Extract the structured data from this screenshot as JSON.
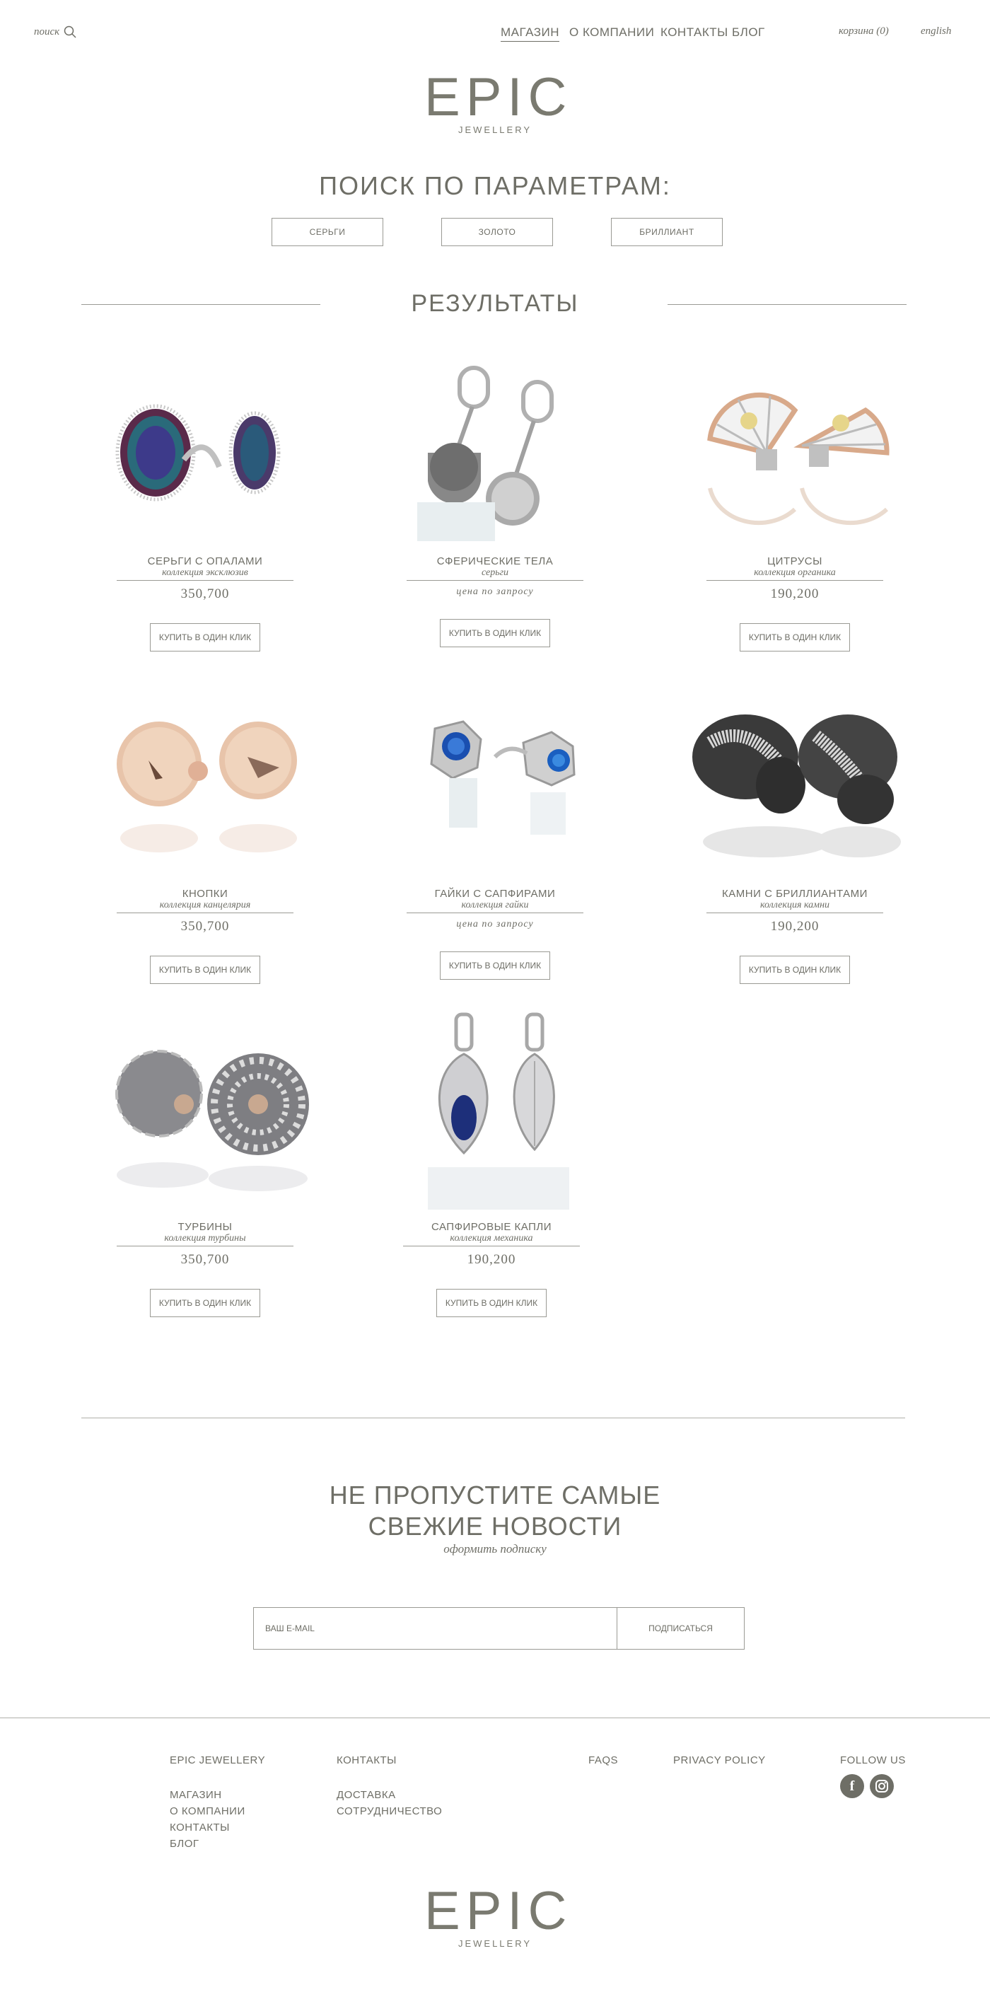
{
  "header": {
    "search_label": "поиск",
    "nav": [
      "МАГАЗИН",
      "О КОМПАНИИ",
      "КОНТАКТЫ",
      "БЛОГ"
    ],
    "cart": "корзина (0)",
    "language": "english"
  },
  "logo": {
    "word": "EPIC",
    "sub": "JEWELLERY"
  },
  "search_params": {
    "heading": "ПОИСК ПО ПАРАМЕТРАМ:",
    "filters": [
      "СЕРЬГИ",
      "ЗОЛОТО",
      "БРИЛЛИАНТ"
    ]
  },
  "results_heading": "РЕЗУЛЬТАТЫ",
  "buy_label": "КУПИТЬ В ОДИН КЛИК",
  "products": [
    {
      "title": "СЕРЬГИ С ОПАЛАМИ",
      "collection": "коллекция эксклюзив",
      "price": "350,700"
    },
    {
      "title": "СФЕРИЧЕСКИЕ ТЕЛА",
      "collection": "серьги",
      "price": "цена по запросу"
    },
    {
      "title": "ЦИТРУСЫ",
      "collection": "коллекция органика",
      "price": "190,200"
    },
    {
      "title": "КНОПКИ",
      "collection": "коллекция канцелярия",
      "price": "350,700"
    },
    {
      "title": "ГАЙКИ С САПФИРАМИ",
      "collection": "коллекция гайки",
      "price": "цена по запросу"
    },
    {
      "title": "КАМНИ С БРИЛЛИАНТАМИ",
      "collection": "коллекция камни",
      "price": "190,200"
    },
    {
      "title": "ТУРБИНЫ",
      "collection": "коллекция турбины",
      "price": "350,700"
    },
    {
      "title": "САПФИРОВЫЕ КАПЛИ",
      "collection": "коллекция механика",
      "price": "190,200"
    }
  ],
  "newsletter": {
    "heading_line1": "НЕ ПРОПУСТИТЕ САМЫЕ",
    "heading_line2": "СВЕЖИЕ НОВОСТИ",
    "subscribe_link": "оформить подписку",
    "email_placeholder": "ВАШ E-MAIL",
    "subscribe_button": "ПОДПИСАТЬСЯ"
  },
  "footer": {
    "col1_head": "EPIC JEWELLERY",
    "col1_links": [
      "МАГАЗИН",
      "О КОМПАНИИ",
      "КОНТАКТЫ",
      "БЛОГ"
    ],
    "col2_head": "КОНТАКТЫ",
    "col2_links": [
      "ДОСТАВКА",
      "СОТРУДНИЧЕСТВО"
    ],
    "faqs": "FAQS",
    "privacy": "PRIVACY POLICY",
    "follow": "FOLLOW US",
    "social": [
      "facebook-icon",
      "instagram-icon"
    ]
  },
  "colors": {
    "text": "#6e6e66",
    "border": "#9a9a94",
    "logo": "#7a7a70"
  }
}
